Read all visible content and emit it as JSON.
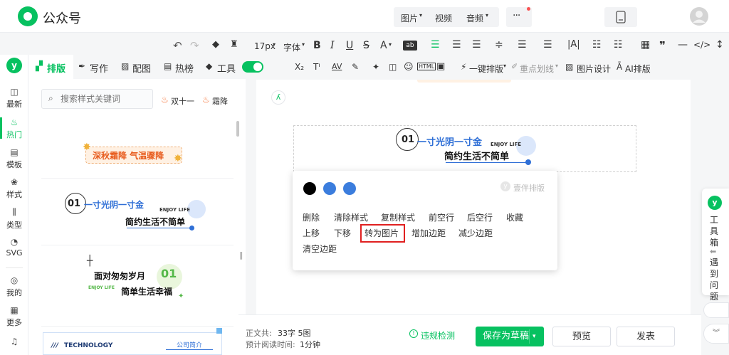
{
  "brand": {
    "name": "公众号"
  },
  "topnav": {
    "image": "图片",
    "video": "视频",
    "audio": "音频",
    "more": "···"
  },
  "toolbar": {
    "font_size": "17px",
    "font_family": "字体",
    "bold": "B",
    "italic": "I",
    "underline": "U",
    "strike": "S",
    "font_color": "A",
    "one_click_layout": "一键排版",
    "highlight": "重点划线",
    "image_design": "图片设计",
    "ai_layout": "AI排版",
    "quote": "❞",
    "code": "</>"
  },
  "tabs": [
    {
      "label": "排版",
      "icon": "layout-icon"
    },
    {
      "label": "写作",
      "icon": "pen-icon"
    },
    {
      "label": "配图",
      "icon": "image-icon"
    },
    {
      "label": "热榜",
      "icon": "hot-icon"
    },
    {
      "label": "工具",
      "icon": "box-icon"
    }
  ],
  "rail": {
    "items": [
      {
        "label": "最新",
        "icon": "newest-icon"
      },
      {
        "label": "热门",
        "icon": "hot-icon"
      },
      {
        "label": "模板",
        "icon": "template-icon"
      },
      {
        "label": "样式",
        "icon": "style-icon"
      },
      {
        "label": "类型",
        "icon": "type-icon"
      },
      {
        "label": "SVG",
        "icon": "svg-icon"
      },
      {
        "label": "我的",
        "icon": "user-icon"
      },
      {
        "label": "更多",
        "icon": "more-icon"
      }
    ]
  },
  "panel": {
    "search_placeholder": "搜索样式关键词",
    "hot_tags": [
      "双十一",
      "霜降"
    ],
    "templates": [
      {
        "text": "深秋霜降 气温骤降"
      },
      {
        "num": "01",
        "line1": "一寸光阴一寸金",
        "badge": "ENJOY LIFE",
        "line2": "简约生活不简单"
      },
      {
        "line1": "面对匆匆岁月",
        "num": "01",
        "badge": "ENJOY LIFE",
        "line2": "简单生活幸福"
      },
      {
        "brand": "TECHNOLOGY",
        "tag": "公司简介"
      }
    ]
  },
  "editor": {
    "block": {
      "num": "01",
      "line1": "一寸光阴一寸金",
      "badge": "ENJOY LIFE",
      "line2": "简约生活不简单"
    }
  },
  "popup": {
    "colors": [
      "#000000",
      "#3b7ddd",
      "#3b7ddd"
    ],
    "partner": "壹伴排版",
    "actions_row1": [
      "删除",
      "清除样式",
      "复制样式",
      "前空行",
      "后空行",
      "收藏"
    ],
    "actions_row2": [
      "上移",
      "下移",
      "转为图片",
      "增加边距",
      "减少边距"
    ],
    "actions_row3": [
      "清空边距"
    ],
    "highlighted": "转为图片"
  },
  "status": {
    "word_label": "正文共:",
    "word_count": "33字 5图",
    "read_label": "预计阅读时间:",
    "read_time": "1分钟",
    "compliance": "违规检测"
  },
  "buttons": {
    "save": "保存为草稿",
    "preview": "预览",
    "publish": "发表"
  },
  "rightrail": {
    "toolbox": "工具箱",
    "feedback": "遇到问题"
  }
}
